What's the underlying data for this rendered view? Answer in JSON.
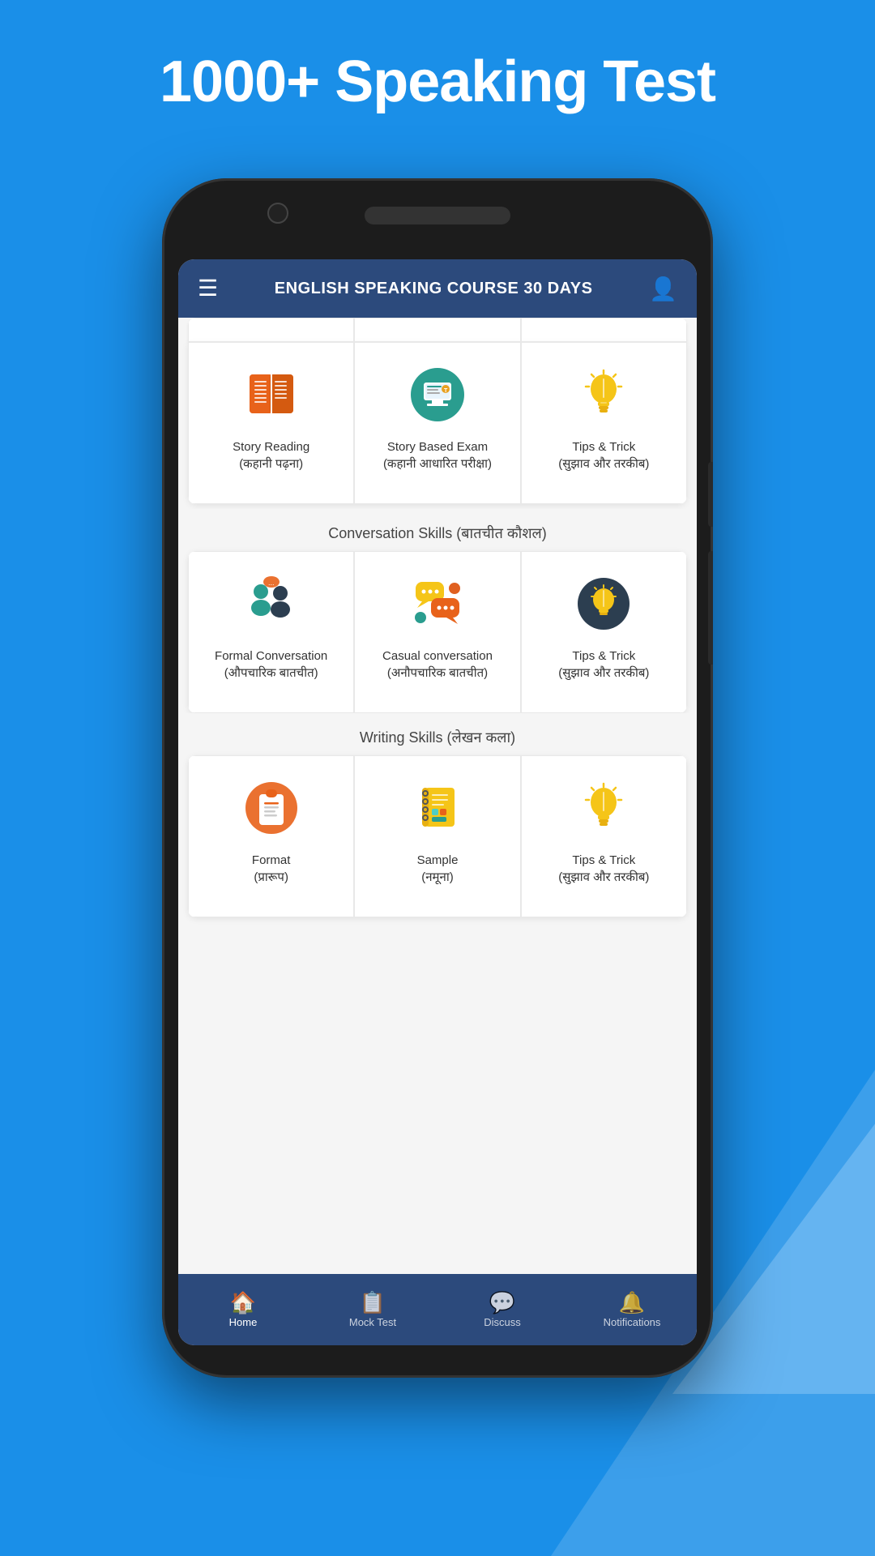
{
  "background": {
    "color": "#1a8fe8"
  },
  "headline": "1000+ Speaking Test",
  "app_header": {
    "title": "ENGLISH SPEAKING COURSE 30 DAYS",
    "menu_icon": "☰",
    "profile_icon": "👤"
  },
  "sections": [
    {
      "id": "reading",
      "label": null,
      "cards": [
        {
          "id": "story-reading",
          "label": "Story Reading\n(कहानी पढ़ना)",
          "label_line1": "Story Reading",
          "label_line2": "(कहानी पढ़ना)",
          "icon_type": "book",
          "icon_emoji": "📖"
        },
        {
          "id": "story-exam",
          "label": "Story Based Exam\n(कहानी आधारित परीक्षा)",
          "label_line1": "Story Based Exam",
          "label_line2": "(कहानी आधारित परीक्षा)",
          "icon_type": "monitor",
          "icon_emoji": "🖥️"
        },
        {
          "id": "tips-trick-1",
          "label": "Tips & Trick\n(सुझाव और तरकीब)",
          "label_line1": "Tips & Trick",
          "label_line2": "(सुझाव और तरकीब)",
          "icon_type": "bulb",
          "icon_emoji": "💡"
        }
      ]
    },
    {
      "id": "conversation",
      "label": "Conversation Skills (बातचीत कौशल)",
      "cards": [
        {
          "id": "formal-conversation",
          "label": "Formal Conversation\n(औपचारिक बातचीत)",
          "label_line1": "Formal Conversation",
          "label_line2": "(औपचारिक बातचीत)",
          "icon_type": "people",
          "icon_emoji": "👥"
        },
        {
          "id": "casual-conversation",
          "label": "Casual conversation\n(अनौपचारिक बातचीत)",
          "label_line1": "Casual conversation",
          "label_line2": "(अनौपचारिक बातचीत)",
          "icon_type": "chat",
          "icon_emoji": "💬"
        },
        {
          "id": "tips-trick-2",
          "label": "Tips & Trick\n(सुझाव और तरकीब)",
          "label_line1": "Tips & Trick",
          "label_line2": "(सुझाव और तरकीब)",
          "icon_type": "bulb-dark",
          "icon_emoji": "💡"
        }
      ]
    },
    {
      "id": "writing",
      "label": "Writing Skills (लेखन कला)",
      "cards": [
        {
          "id": "format",
          "label": "Format\n(प्रारूप)",
          "label_line1": "Format",
          "label_line2": "(प्रारूप)",
          "icon_type": "clipboard",
          "icon_emoji": "📋"
        },
        {
          "id": "sample",
          "label": "Sample\n(नमूना)",
          "label_line1": "Sample",
          "label_line2": "(नमूना)",
          "icon_type": "notebook",
          "icon_emoji": "📓"
        },
        {
          "id": "tips-trick-3",
          "label": "Tips & Trick\n(सुझाव और तरकीब)",
          "label_line1": "Tips & Trick",
          "label_line2": "(सुझाव और तरकीब)",
          "icon_type": "bulb",
          "icon_emoji": "💡"
        }
      ]
    }
  ],
  "bottom_nav": [
    {
      "id": "home",
      "label": "Home",
      "icon": "🏠",
      "active": true
    },
    {
      "id": "mock-test",
      "label": "Mock Test",
      "icon": "📋",
      "active": false
    },
    {
      "id": "discuss",
      "label": "Discuss",
      "icon": "💬",
      "active": false
    },
    {
      "id": "notifications",
      "label": "Notifications",
      "icon": "🔔",
      "active": false
    }
  ]
}
